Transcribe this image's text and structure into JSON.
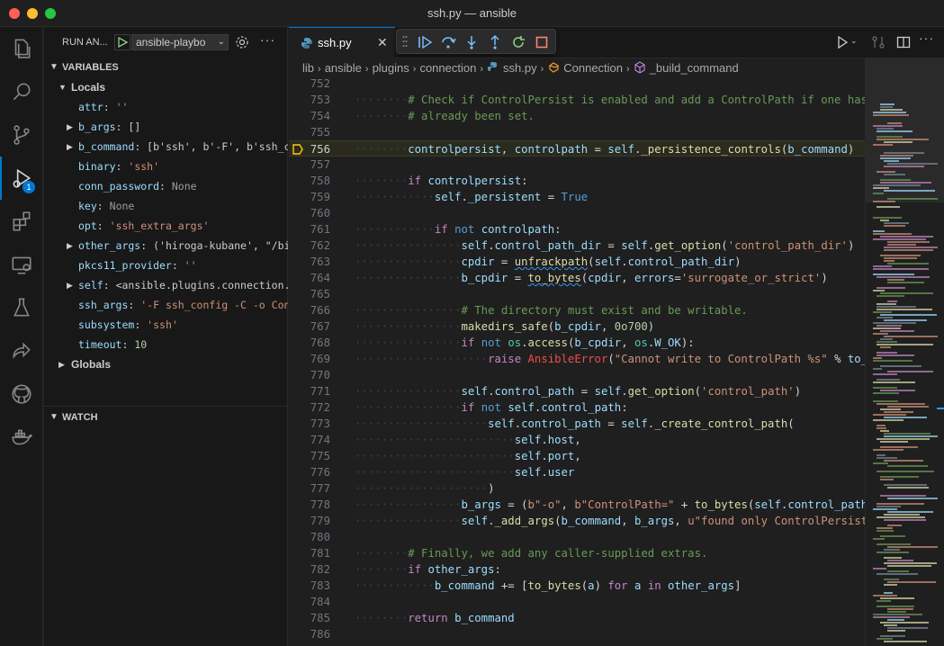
{
  "window": {
    "title": "ssh.py — ansible"
  },
  "activity_bar": {
    "debug_badge": "1"
  },
  "sidebar": {
    "run_label": "RUN AN...",
    "config_name": "ansible-playbo",
    "variables_title": "VARIABLES",
    "locals_label": "Locals",
    "globals_label": "Globals",
    "watch_title": "WATCH",
    "variables": [
      {
        "name": "attr",
        "value": "''",
        "kind": "str",
        "expandable": false
      },
      {
        "name": "b_args",
        "value": "[]",
        "kind": "obj",
        "expandable": true
      },
      {
        "name": "b_command",
        "value": "[b'ssh', b'-F', b'ssh_c...",
        "kind": "obj",
        "expandable": true
      },
      {
        "name": "binary",
        "value": "'ssh'",
        "kind": "str",
        "expandable": false
      },
      {
        "name": "conn_password",
        "value": "None",
        "kind": "none",
        "expandable": false
      },
      {
        "name": "key",
        "value": "None",
        "kind": "none",
        "expandable": false
      },
      {
        "name": "opt",
        "value": "'ssh_extra_args'",
        "kind": "str",
        "expandable": false
      },
      {
        "name": "other_args",
        "value": "('hiroga-kubane', \"/bi...",
        "kind": "obj",
        "expandable": true
      },
      {
        "name": "pkcs11_provider",
        "value": "''",
        "kind": "str",
        "expandable": false
      },
      {
        "name": "self",
        "value": "<ansible.plugins.connection...",
        "kind": "obj",
        "expandable": true
      },
      {
        "name": "ssh_args",
        "value": "'-F ssh_config -C -o Con...",
        "kind": "str",
        "expandable": false
      },
      {
        "name": "subsystem",
        "value": "'ssh'",
        "kind": "str",
        "expandable": false
      },
      {
        "name": "timeout",
        "value": "10",
        "kind": "num",
        "expandable": false
      }
    ]
  },
  "editor": {
    "tab_label": "ssh.py",
    "breadcrumb": [
      "lib",
      "ansible",
      "plugins",
      "connection",
      "ssh.py",
      "Connection",
      "_build_command"
    ],
    "current_line": "756",
    "lines": [
      {
        "n": "752",
        "indent": 0,
        "html": ""
      },
      {
        "n": "753",
        "indent": 2,
        "html": "<span class=\"c-cmt\"># Check if ControlPersist is enabled and add a ControlPath if one hasn't</span>"
      },
      {
        "n": "754",
        "indent": 2,
        "html": "<span class=\"c-cmt\"># already been set.</span>"
      },
      {
        "n": "755",
        "indent": 0,
        "html": ""
      },
      {
        "n": "756",
        "indent": 2,
        "html": "<span class=\"c-var\">controlpersist</span>, <span class=\"c-var\">controlpath</span> = <span class=\"c-var\">self</span>.<span class=\"c-fn\">_persistence_controls</span>(<span class=\"c-var\">b_command</span>)"
      },
      {
        "n": "757",
        "indent": 0,
        "html": ""
      },
      {
        "n": "758",
        "indent": 2,
        "html": "<span class=\"c-kw\">if</span> <span class=\"c-var\">controlpersist</span>:"
      },
      {
        "n": "759",
        "indent": 3,
        "html": "<span class=\"c-var\">self</span>.<span class=\"c-var\">_persistent</span> = <span class=\"c-bool\">True</span>"
      },
      {
        "n": "760",
        "indent": 0,
        "html": ""
      },
      {
        "n": "761",
        "indent": 3,
        "html": "<span class=\"c-kw\">if</span> <span class=\"c-kw2\">not</span> <span class=\"c-var\">controlpath</span>:"
      },
      {
        "n": "762",
        "indent": 4,
        "html": "<span class=\"c-var\">self</span>.<span class=\"c-var\">control_path_dir</span> = <span class=\"c-var\">self</span>.<span class=\"c-fn\">get_option</span>(<span class=\"c-str\">'control_path_dir'</span>)"
      },
      {
        "n": "763",
        "indent": 4,
        "html": "<span class=\"c-var\">cpdir</span> = <span class=\"c-fn squig\">unfrackpath</span>(<span class=\"c-var\">self</span>.<span class=\"c-var\">control_path_dir</span>)"
      },
      {
        "n": "764",
        "indent": 4,
        "html": "<span class=\"c-var\">b_cpdir</span> = <span class=\"c-fn squig\">to_bytes</span>(<span class=\"c-var\">cpdir</span>, <span class=\"c-var\">errors</span>=<span class=\"c-str\">'surrogate_or_strict'</span>)"
      },
      {
        "n": "765",
        "indent": 0,
        "html": ""
      },
      {
        "n": "766",
        "indent": 4,
        "html": "<span class=\"c-cmt\"># The directory must exist and be writable.</span>"
      },
      {
        "n": "767",
        "indent": 4,
        "html": "<span class=\"c-fn\">makedirs_safe</span>(<span class=\"c-var\">b_cpdir</span>, <span class=\"c-num\">0o700</span>)"
      },
      {
        "n": "768",
        "indent": 4,
        "html": "<span class=\"c-kw\">if</span> <span class=\"c-kw2\">not</span> <span class=\"c-cls\">os</span>.<span class=\"c-fn\">access</span>(<span class=\"c-var\">b_cpdir</span>, <span class=\"c-cls\">os</span>.<span class=\"c-var\">W_OK</span>):"
      },
      {
        "n": "769",
        "indent": 5,
        "html": "<span class=\"c-kw\">raise</span> <span class=\"c-err\">AnsibleError</span>(<span class=\"c-str\">\"Cannot write to ControlPath %s\"</span> % <span class=\"c-var\">to_nat</span>"
      },
      {
        "n": "770",
        "indent": 0,
        "html": ""
      },
      {
        "n": "771",
        "indent": 4,
        "html": "<span class=\"c-var\">self</span>.<span class=\"c-var\">control_path</span> = <span class=\"c-var\">self</span>.<span class=\"c-fn\">get_option</span>(<span class=\"c-str\">'control_path'</span>)"
      },
      {
        "n": "772",
        "indent": 4,
        "html": "<span class=\"c-kw\">if</span> <span class=\"c-kw2\">not</span> <span class=\"c-var\">self</span>.<span class=\"c-var\">control_path</span>:"
      },
      {
        "n": "773",
        "indent": 5,
        "html": "<span class=\"c-var\">self</span>.<span class=\"c-var\">control_path</span> = <span class=\"c-var\">self</span>.<span class=\"c-fn\">_create_control_path</span>("
      },
      {
        "n": "774",
        "indent": 6,
        "html": "<span class=\"c-var\">self</span>.<span class=\"c-var\">host</span>,"
      },
      {
        "n": "775",
        "indent": 6,
        "html": "<span class=\"c-var\">self</span>.<span class=\"c-var\">port</span>,"
      },
      {
        "n": "776",
        "indent": 6,
        "html": "<span class=\"c-var\">self</span>.<span class=\"c-var\">user</span>"
      },
      {
        "n": "777",
        "indent": 5,
        "html": ")"
      },
      {
        "n": "778",
        "indent": 4,
        "html": "<span class=\"c-var\">b_args</span> = (<span class=\"c-str\">b\"-o\"</span>, <span class=\"c-str\">b\"ControlPath=\"</span> + <span class=\"c-fn\">to_bytes</span>(<span class=\"c-var\">self</span>.<span class=\"c-var\">control_path</span>"
      },
      {
        "n": "779",
        "indent": 4,
        "html": "<span class=\"c-var\">self</span>.<span class=\"c-fn\">_add_args</span>(<span class=\"c-var\">b_command</span>, <span class=\"c-var\">b_args</span>, <span class=\"c-str\">u\"found only ControlPersist;</span>"
      },
      {
        "n": "780",
        "indent": 0,
        "html": ""
      },
      {
        "n": "781",
        "indent": 2,
        "html": "<span class=\"c-cmt\"># Finally, we add any caller-supplied extras.</span>"
      },
      {
        "n": "782",
        "indent": 2,
        "html": "<span class=\"c-kw\">if</span> <span class=\"c-var\">other_args</span>:"
      },
      {
        "n": "783",
        "indent": 3,
        "html": "<span class=\"c-var\">b_command</span> += [<span class=\"c-fn\">to_bytes</span>(<span class=\"c-var\">a</span>) <span class=\"c-kw\">for</span> <span class=\"c-var\">a</span> <span class=\"c-kw\">in</span> <span class=\"c-var\">other_args</span>]"
      },
      {
        "n": "784",
        "indent": 0,
        "html": ""
      },
      {
        "n": "785",
        "indent": 2,
        "html": "<span class=\"c-kw\">return</span> <span class=\"c-var\">b_command</span>"
      },
      {
        "n": "786",
        "indent": 0,
        "html": ""
      }
    ]
  }
}
